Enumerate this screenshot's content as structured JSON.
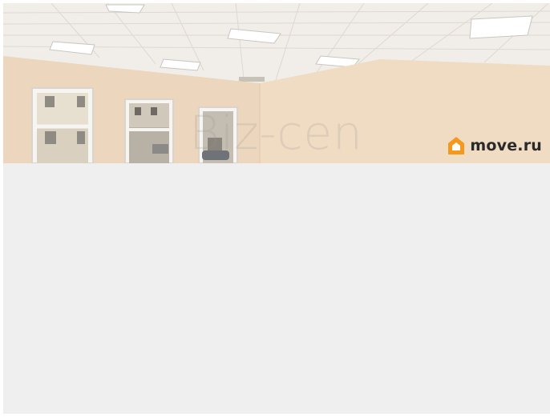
{
  "photo": {
    "watermark_text": "Biz-cen",
    "brand": {
      "logo_icon": "house-logo-icon",
      "name": "move.ru",
      "logo_color": "#f39a1e"
    }
  },
  "colors": {
    "page_background": "#efefef",
    "ceiling": "#f1eee9",
    "wall": "#efd8bf"
  }
}
